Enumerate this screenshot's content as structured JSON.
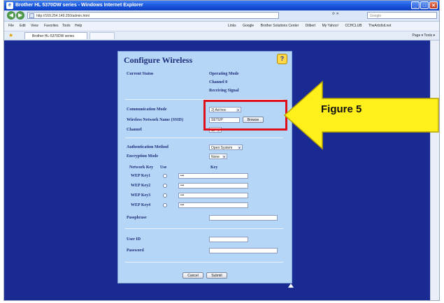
{
  "window": {
    "title": "Brother HL 5370DW series - Windows Internet Explorer",
    "address": "http://169.254.149.250/admin.html",
    "search_placeholder": "Google"
  },
  "menu": [
    "File",
    "Edit",
    "View",
    "Favorites",
    "Tools",
    "Help"
  ],
  "links": [
    "Links",
    "Google",
    "Brother Solutions Center",
    "Dilbert",
    "My Yahoo!",
    "CCHCLUB",
    "TheArtofsit.net"
  ],
  "tab": {
    "label": "Brother HL-5370DW series"
  },
  "tab_tools": "Page ▾  Tools ▾",
  "panel": {
    "title": "Configure Wireless",
    "help": "?",
    "current_status_label": "Current Status",
    "status_values": [
      "Operating Mode",
      "Channel   0",
      "Receiving Signal"
    ],
    "communication_mode_label": "Communication Mode",
    "communication_mode_value": "2) Ad-hoc",
    "ssid_label": "Wireless Network Name (SSID)",
    "ssid_value": "SETUP",
    "browse_label": "Browse",
    "channel_label": "Channel",
    "channel_value": "11",
    "auth_method_label": "Authentication Method",
    "auth_method_value": "Open System",
    "encryption_mode_label": "Encryption Mode",
    "encryption_mode_value": "None",
    "network_key_header": "Network Key",
    "use_header": "Use",
    "key_header": "Key",
    "wep_keys": [
      {
        "label": "WEP Key1",
        "value": "•••"
      },
      {
        "label": "WEP Key2",
        "value": "•••"
      },
      {
        "label": "WEP Key3",
        "value": "•••"
      },
      {
        "label": "WEP Key4",
        "value": "•••"
      }
    ],
    "passphrase_label": "Passphrase",
    "user_id_label": "User ID",
    "password_label": "Password",
    "cancel_label": "Cancel",
    "submit_label": "Submit"
  },
  "callout": {
    "label": "Figure 5",
    "arrow_color": "#ffef1a",
    "box_color": "#e0101a"
  },
  "colors": {
    "background": "#1a2a93",
    "panel": "#b6d6f7",
    "panel_text": "#1d2d7a"
  }
}
